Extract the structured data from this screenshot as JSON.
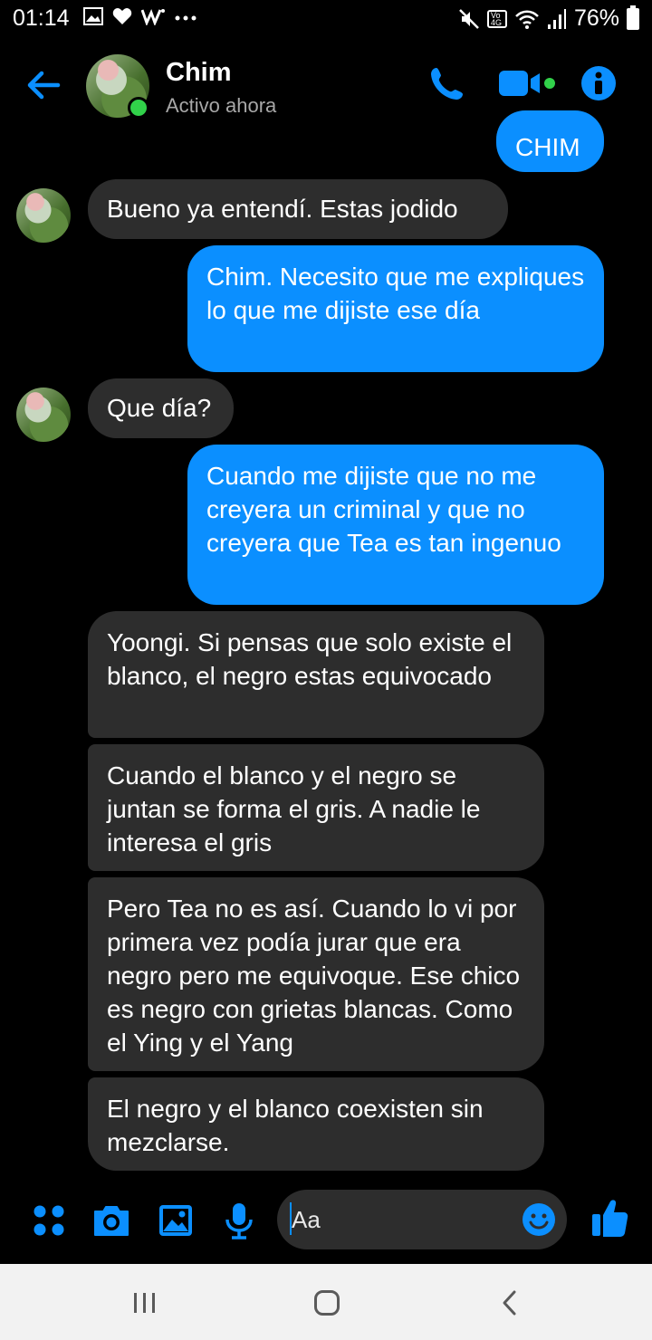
{
  "status": {
    "time": "01:14",
    "battery": "76%",
    "left_icons": [
      "gallery-icon",
      "heart-icon",
      "w-icon",
      "more-dots-icon"
    ],
    "right_icons": [
      "mute-icon",
      "volte-4g-icon",
      "wifi-icon",
      "signal-icon",
      "battery-icon"
    ]
  },
  "header": {
    "name": "Chim",
    "status": "Activo ahora",
    "back_icon": "arrow-left-icon",
    "call_icon": "phone-icon",
    "video_icon": "video-camera-icon",
    "info_icon": "info-icon"
  },
  "messages": [
    {
      "side": "out",
      "text": "CHIM"
    },
    {
      "side": "in",
      "text": "Bueno ya entendí. Estas jodido"
    },
    {
      "side": "out",
      "text": "Chim. Necesito que me expliques lo que me dijiste ese día"
    },
    {
      "side": "in",
      "text": "Que día?"
    },
    {
      "side": "out",
      "text": "Cuando me dijiste que no me creyera un criminal y que no creyera que Tea es tan ingenuo"
    },
    {
      "side": "in",
      "text": "Yoongi. Si pensas que solo existe el blanco, el negro estas equivocado"
    },
    {
      "side": "in",
      "text": "Cuando el blanco y el negro se juntan se forma el gris. A nadie le interesa el gris"
    },
    {
      "side": "in",
      "text": "Pero Tea no es así. Cuando lo vi por primera vez podía jurar que era negro pero me equivoque. Ese chico es negro con grietas blancas. Como el Ying y el Yang"
    },
    {
      "side": "in",
      "text": "El negro y el blanco coexisten sin mezclarse."
    }
  ],
  "composer": {
    "placeholder": "Aa",
    "icons": [
      "apps-dots-icon",
      "camera-icon",
      "image-icon",
      "microphone-icon",
      "emoji-icon",
      "thumbs-up-icon"
    ]
  },
  "navbar": {
    "icons": [
      "recent-apps-icon",
      "home-icon",
      "back-icon"
    ]
  },
  "colors": {
    "accent": "#0b8fff",
    "incoming_bubble": "#2d2d2d",
    "background": "#000000",
    "online": "#31d14a"
  }
}
